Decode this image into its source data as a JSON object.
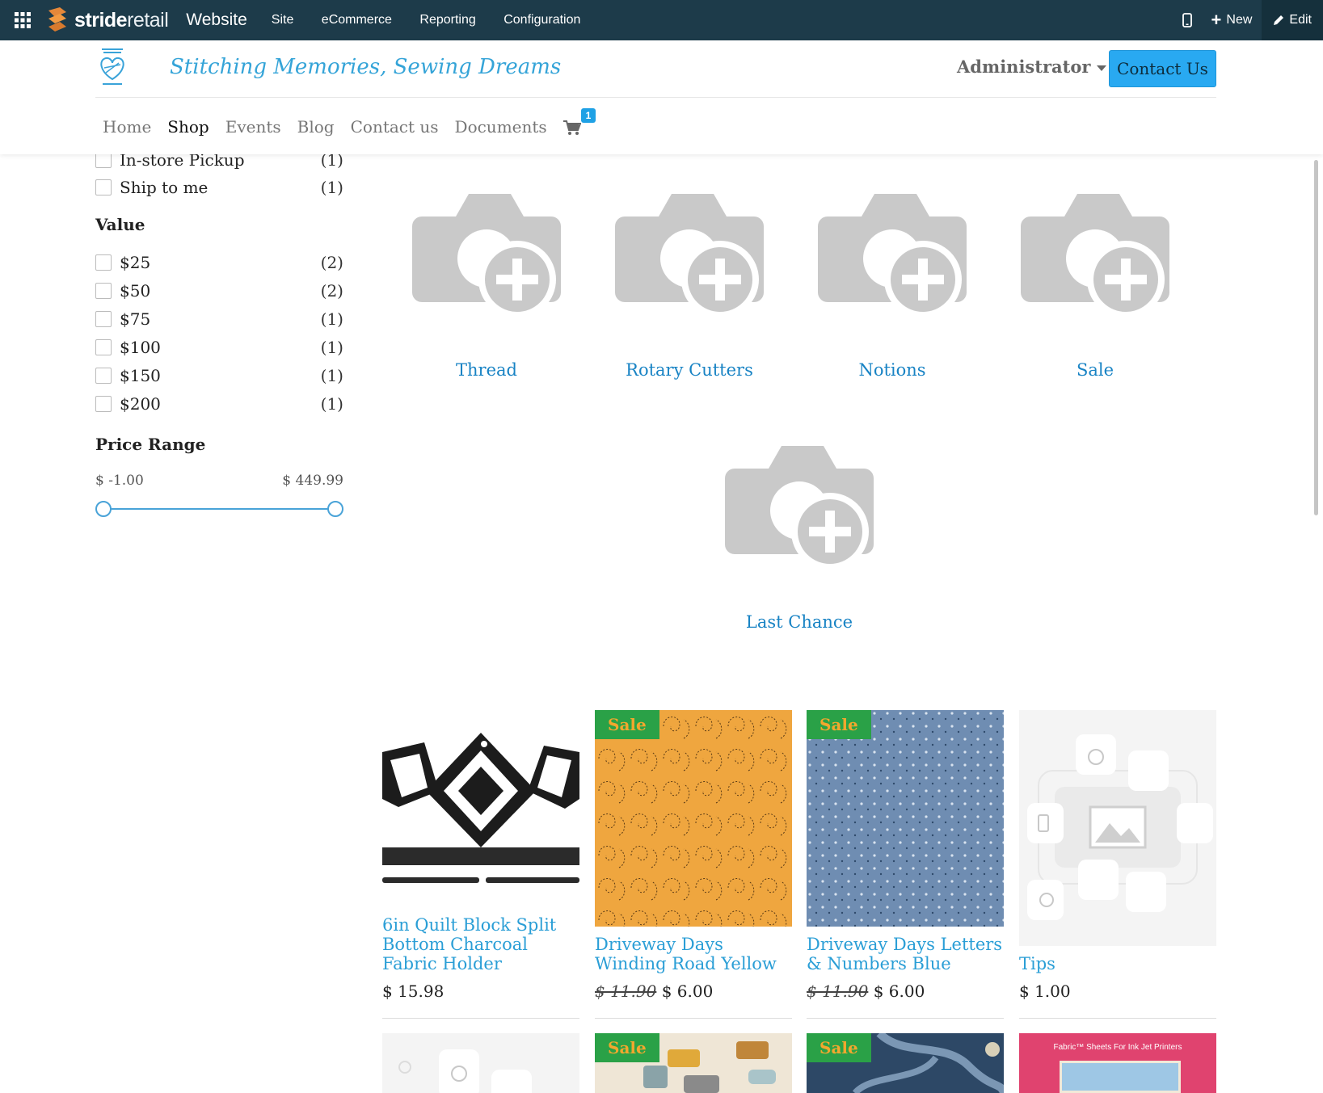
{
  "topbar": {
    "brand_bold": "stride",
    "brand_light": "retail",
    "app": "Website",
    "menu": [
      "Site",
      "eCommerce",
      "Reporting",
      "Configuration"
    ],
    "new_label": "New",
    "edit_label": "Edit"
  },
  "header": {
    "tagline": "Stitching Memories, Sewing Dreams",
    "user": "Administrator",
    "contact_button": "Contact Us",
    "nav": [
      "Home",
      "Shop",
      "Events",
      "Blog",
      "Contact us",
      "Documents"
    ],
    "active_nav": "Shop",
    "cart_count": "1"
  },
  "filters": {
    "delivery": [
      {
        "label": "In-store Pickup",
        "count": "(1)"
      },
      {
        "label": "Ship to me",
        "count": "(1)"
      }
    ],
    "value_title": "Value",
    "values": [
      {
        "label": "$25",
        "count": "(2)"
      },
      {
        "label": "$50",
        "count": "(2)"
      },
      {
        "label": "$75",
        "count": "(1)"
      },
      {
        "label": "$100",
        "count": "(1)"
      },
      {
        "label": "$150",
        "count": "(1)"
      },
      {
        "label": "$200",
        "count": "(1)"
      }
    ],
    "price_title": "Price Range",
    "price_min": "$ -1.00",
    "price_max": "$ 449.99"
  },
  "categories": [
    "Thread",
    "Rotary Cutters",
    "Notions",
    "Sale",
    "Last Chance"
  ],
  "products": [
    {
      "name": "6in Quilt Block Split Bottom Charcoal Fabric Holder",
      "price": "$ 15.98",
      "old_price": "",
      "sale": false
    },
    {
      "name": "Driveway Days Winding Road Yellow",
      "price": "$ 6.00",
      "old_price": "$ 11.90",
      "sale": true
    },
    {
      "name": "Driveway Days Letters & Numbers Blue",
      "price": "$ 6.00",
      "old_price": "$ 11.90",
      "sale": true
    },
    {
      "name": "Tips",
      "price": "$ 1.00",
      "old_price": "",
      "sale": false
    }
  ],
  "sale_label": "Sale",
  "row2": {
    "ad_text": "Fabric™ Sheets For Ink Jet Printers"
  },
  "colors": {
    "topbar": "#1d3b4a",
    "accent": "#29a9f1",
    "link": "#1883c4",
    "sale_bg": "#2aa147",
    "sale_text": "#f2a72e"
  }
}
